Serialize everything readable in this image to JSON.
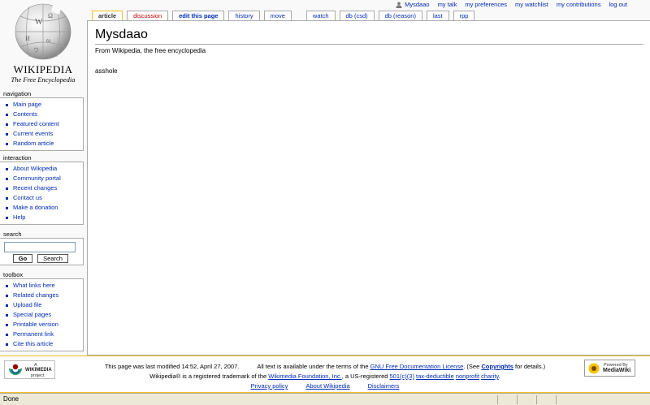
{
  "personal": {
    "user": "Mysdaao",
    "items": [
      "my talk",
      "my preferences",
      "my watchlist",
      "my contributions",
      "log out"
    ]
  },
  "logo": {
    "title": "Wikipedia",
    "subtitle": "The Free Encyclopedia"
  },
  "tabs": {
    "article": "article",
    "discussion": "discussion",
    "edit": "edit this page",
    "history": "history",
    "move": "move",
    "watch": "watch",
    "db_csd": "db (csd)",
    "db_reason": "db (reason)",
    "last": "last",
    "rpp": "rpp"
  },
  "content": {
    "heading": "Mysdaao",
    "site_sub": "From Wikipedia, the free encyclopedia",
    "body": "asshole"
  },
  "sidebar": {
    "navigation": {
      "title": "navigation",
      "items": [
        "Main page",
        "Contents",
        "Featured content",
        "Current events",
        "Random article"
      ]
    },
    "interaction": {
      "title": "interaction",
      "items": [
        "About Wikipedia",
        "Community portal",
        "Recent changes",
        "Contact us",
        "Make a donation",
        "Help"
      ]
    },
    "search": {
      "title": "search",
      "go_label": "Go",
      "search_label": "Search",
      "value": ""
    },
    "toolbox": {
      "title": "toolbox",
      "items": [
        "What links here",
        "Related changes",
        "Upload file",
        "Special pages",
        "Printable version",
        "Permanent link",
        "Cite this article"
      ]
    }
  },
  "footer": {
    "last_modified": "This page was last modified 14:52, April 27, 2007.",
    "license_pre": "All text is available under the terms of the",
    "license_link": "GNU Free Documentation License",
    "license_mid": ". (See",
    "copyrights_link": "Copyrights",
    "license_post": "for details.)",
    "trademark_pre": "Wikipedia® is a registered trademark of the",
    "foundation_link": "Wikimedia Foundation, Inc.",
    "trademark_mid": ", a US-registered",
    "c3_link": "501(c)(3)",
    "taxded_link": "tax-deductible",
    "nonprofit_link": "nonprofit",
    "charity_link": "charity",
    "privacy": "Privacy policy",
    "about": "About Wikipedia",
    "disclaimers": "Disclaimers",
    "wikimedia_badge_a": "A",
    "wikimedia_badge_main": "WIKIMEDIA",
    "wikimedia_badge_sub": "project",
    "mediawiki_badge_top": "Powered By",
    "mediawiki_badge_main": "MediaWiki"
  },
  "status": {
    "text": "Done"
  },
  "colors": {
    "link": "#002bb8",
    "new_link": "#ba0000",
    "tab_selected_border": "#fabd23"
  }
}
